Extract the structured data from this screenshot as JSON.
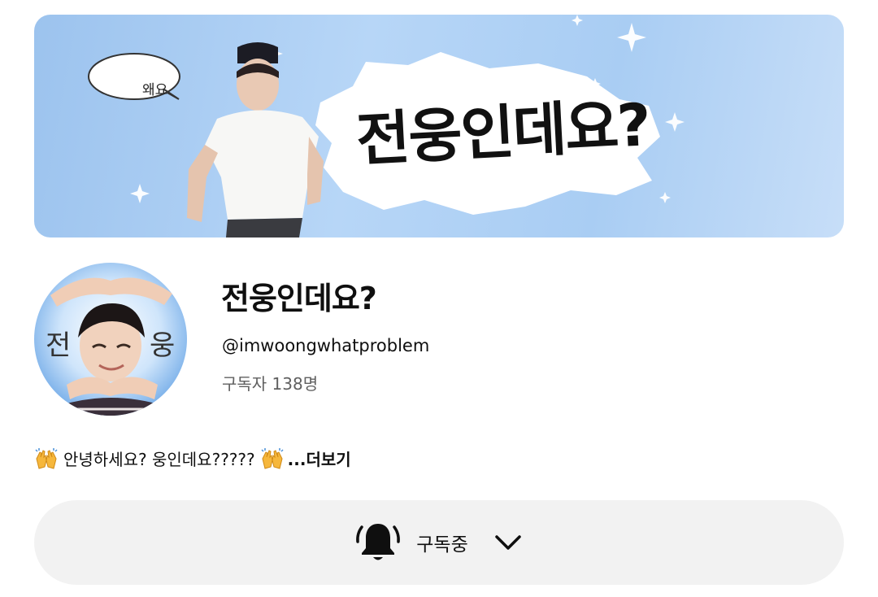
{
  "banner": {
    "speech_bubble_text": "왜요",
    "title_text": "전웅인데요?"
  },
  "avatar": {
    "left_char": "전",
    "right_char": "웅"
  },
  "channel": {
    "name": "전웅인데요?",
    "handle": "@imwoongwhatproblem",
    "subscribers": "구독자 138명"
  },
  "description": {
    "text": "안녕하세요? 웅인데요?????",
    "more_label": "...더보기"
  },
  "subscribe": {
    "label": "구독중"
  },
  "icons": {
    "bell": "bell-icon",
    "chevron": "chevron-down-icon",
    "raised_hands": "raised-hands-emoji"
  }
}
